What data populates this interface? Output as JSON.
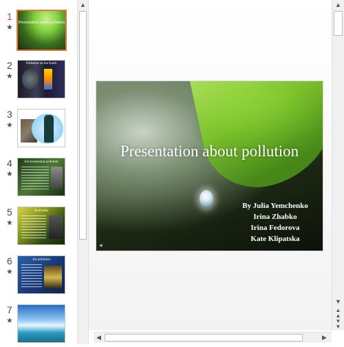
{
  "thumbnails": [
    {
      "number": "1",
      "star": "★",
      "title": "Presentation about pollution",
      "active": true
    },
    {
      "number": "2",
      "star": "★",
      "title": "Pollution on the Earth",
      "active": false
    },
    {
      "number": "3",
      "star": "★",
      "title": "",
      "active": false
    },
    {
      "number": "4",
      "star": "★",
      "title": "Environmental pollution",
      "active": false
    },
    {
      "number": "5",
      "star": "★",
      "title": "Acid rains",
      "active": false
    },
    {
      "number": "6",
      "star": "★",
      "title": "Air pollution",
      "active": false
    },
    {
      "number": "7",
      "star": "★",
      "title": "",
      "active": false
    }
  ],
  "main_slide": {
    "title": "Presentation about pollution",
    "authors": [
      "By Julia Yemchenko",
      "Irina Zhabko",
      "Irina Fedorova",
      "Kate Klipatska"
    ]
  },
  "icons": {
    "scroll_up": "scroll-up-arrow-icon",
    "scroll_down": "scroll-down-arrow-icon",
    "prev_slide": "previous-slide-icon",
    "next_slide": "next-slide-icon",
    "scroll_left": "scroll-left-arrow-icon",
    "scroll_right": "scroll-right-arrow-icon"
  },
  "colors": {
    "active_accent": "#e2783f",
    "active_number": "#d24726"
  }
}
